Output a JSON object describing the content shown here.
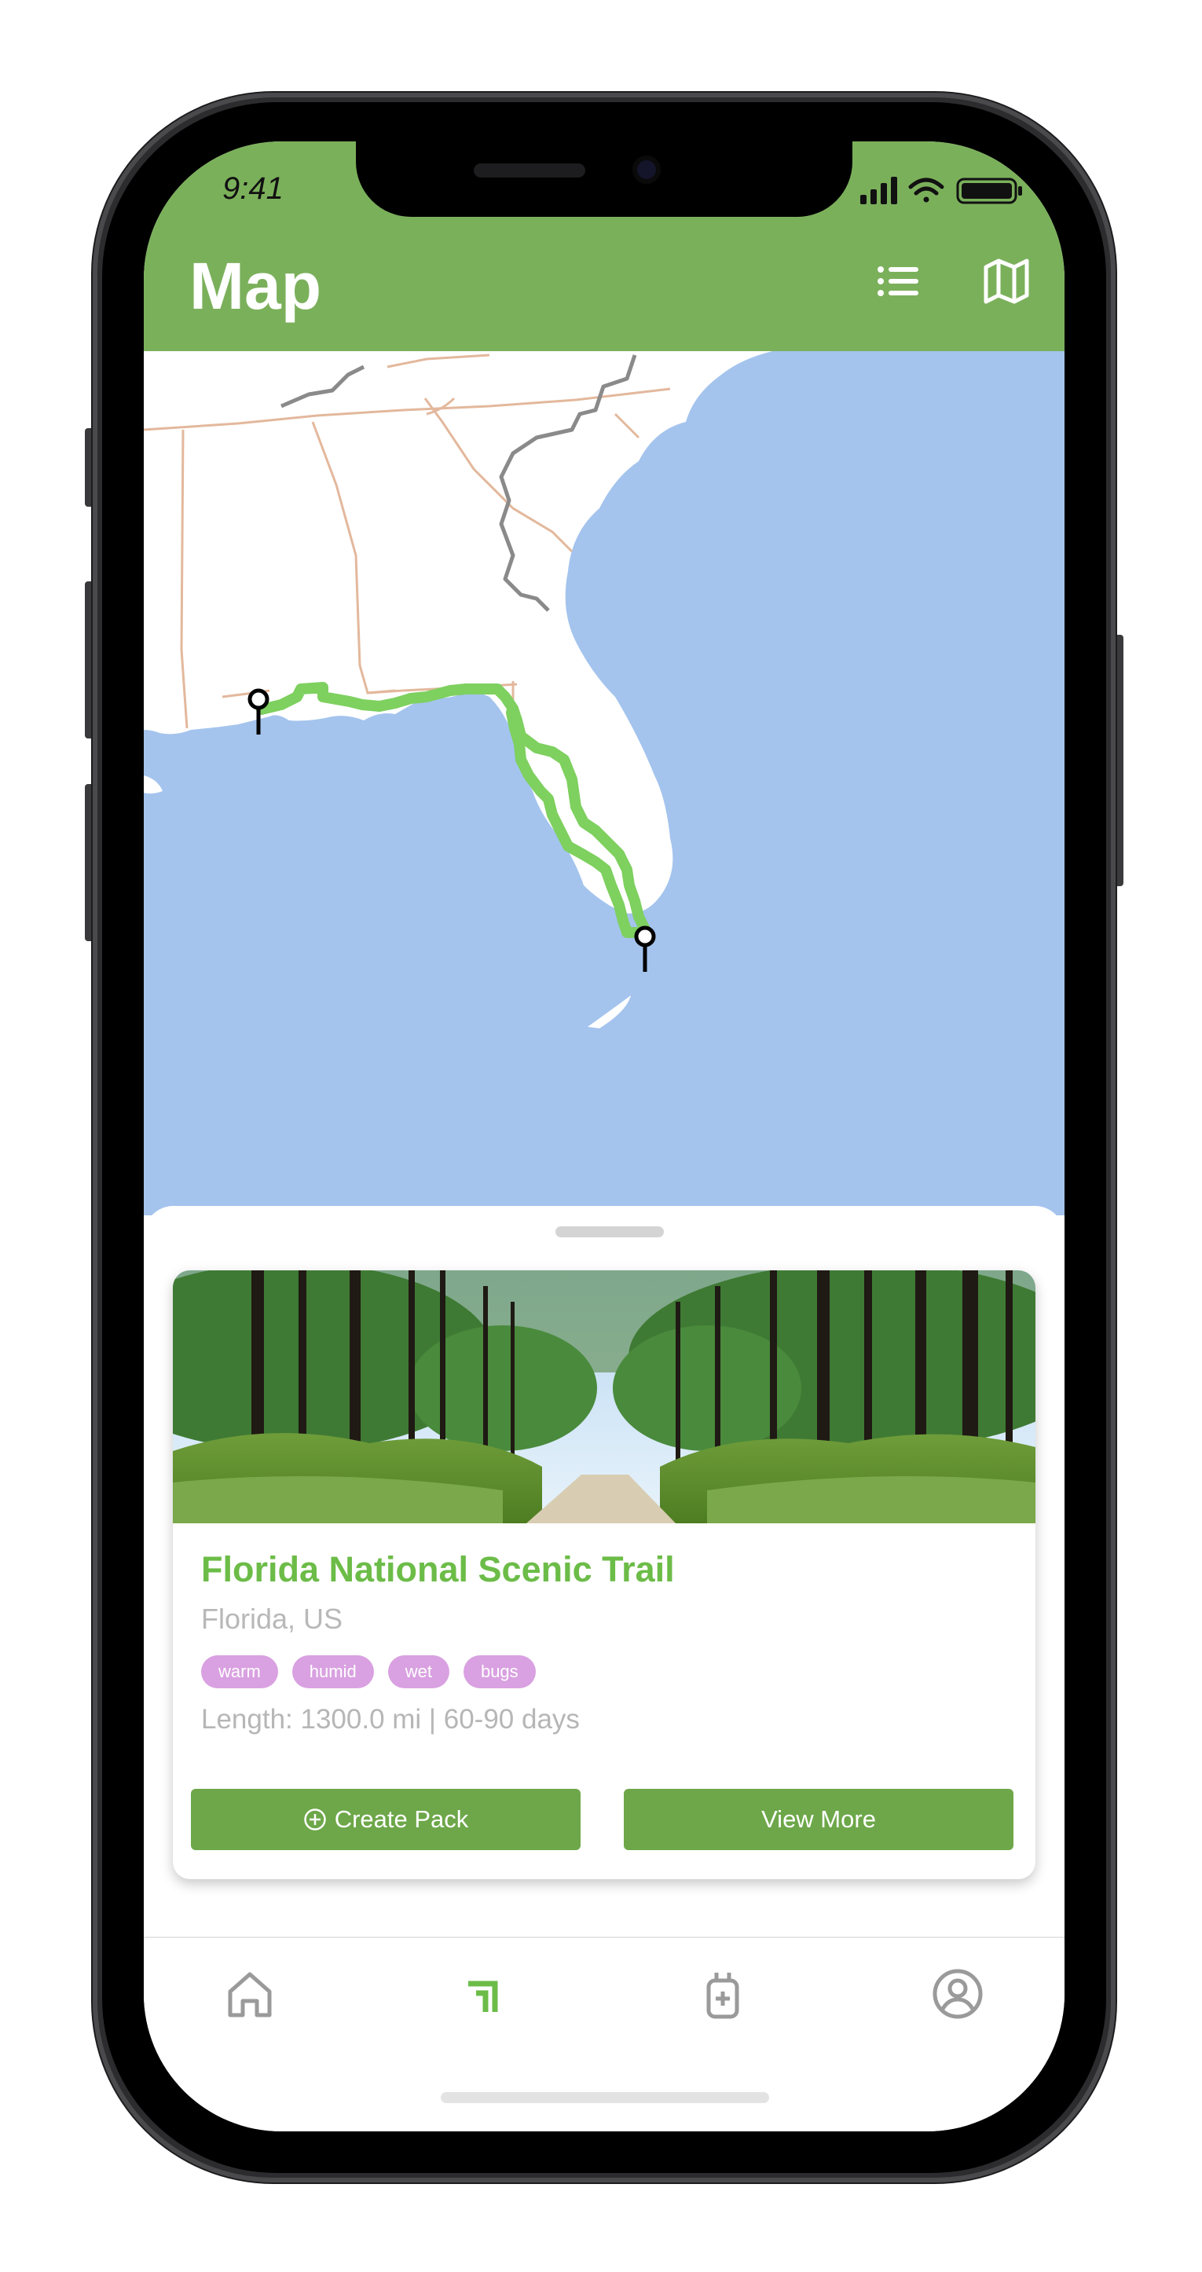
{
  "status_bar": {
    "time": "9:41"
  },
  "header": {
    "title": "Map",
    "list_icon": "list-icon",
    "map_icon": "map-icon",
    "background_color": "#7bb05b"
  },
  "map": {
    "water_color": "#a4c4ee",
    "land_color": "#ffffff",
    "trail_color": "#7ed05f",
    "start_marker": "map-pin-icon",
    "end_marker": "map-pin-icon"
  },
  "trail_card": {
    "name": "Florida National Scenic Trail",
    "location": "Florida, US",
    "tags": [
      "warm",
      "humid",
      "wet",
      "bugs"
    ],
    "length_line": "Length: 1300.0 mi | 60-90 days",
    "create_button": "Create Pack",
    "create_button_icon": "plus-circle-icon",
    "view_button": "View More",
    "accent_color": "#6cbc48",
    "tag_color": "#d9a1e1"
  },
  "tab_bar": {
    "items": [
      {
        "name": "home",
        "icon": "home-icon",
        "active": false
      },
      {
        "name": "trails",
        "icon": "trail-icon",
        "active": true
      },
      {
        "name": "packs",
        "icon": "backpack-icon",
        "active": false
      },
      {
        "name": "profile",
        "icon": "profile-icon",
        "active": false
      }
    ],
    "active_color": "#6cbc48",
    "inactive_color": "#9a9a9a"
  }
}
